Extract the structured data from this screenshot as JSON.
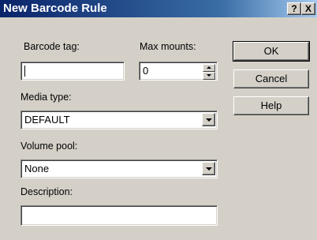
{
  "window": {
    "title": "New Barcode Rule",
    "help_btn": "?",
    "close_btn": "X"
  },
  "form": {
    "barcode_tag_label": "Barcode tag:",
    "barcode_tag_value": "",
    "max_mounts_label": "Max mounts:",
    "max_mounts_value": "0",
    "media_type_label": "Media type:",
    "media_type_value": "DEFAULT",
    "volume_pool_label": "Volume pool:",
    "volume_pool_value": "None",
    "description_label": "Description:",
    "description_value": ""
  },
  "buttons": {
    "ok": "OK",
    "cancel": "Cancel",
    "help": "Help"
  }
}
